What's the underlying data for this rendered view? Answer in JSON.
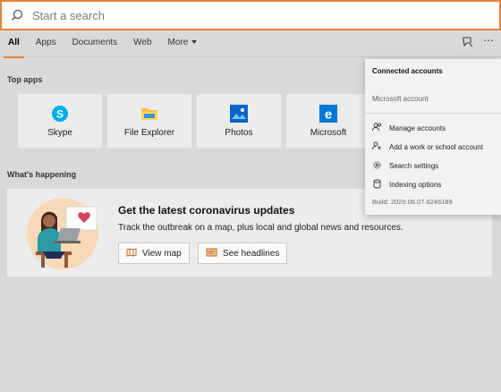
{
  "search": {
    "placeholder": "Start a search"
  },
  "tabs": [
    {
      "label": "All",
      "active": true
    },
    {
      "label": "Apps"
    },
    {
      "label": "Documents"
    },
    {
      "label": "Web"
    },
    {
      "label": "More"
    }
  ],
  "top_apps": {
    "title": "Top apps",
    "items": [
      {
        "label": "Skype",
        "icon": "skype-icon",
        "color": "#00aff0"
      },
      {
        "label": "File Explorer",
        "icon": "folder-icon",
        "color": "#f5c342"
      },
      {
        "label": "Photos",
        "icon": "photos-icon",
        "color": "#0a63c7"
      },
      {
        "label": "Microsoft",
        "icon": "edge-icon",
        "color": "#0078d7"
      }
    ]
  },
  "whats_happening": {
    "title": "What's happening",
    "card": {
      "title": "Get the latest coronavirus updates",
      "description": "Track the outbreak on a map, plus local and global news and resources.",
      "buttons": [
        {
          "label": "View map",
          "icon": "map-icon"
        },
        {
          "label": "See headlines",
          "icon": "news-icon"
        }
      ]
    }
  },
  "dropdown": {
    "header": "Connected accounts",
    "account": "Microsoft account",
    "items": [
      {
        "label": "Manage accounts",
        "icon": "people-icon"
      },
      {
        "label": "Add a work or school account",
        "icon": "add-person-icon"
      },
      {
        "label": "Search settings",
        "icon": "gear-icon"
      },
      {
        "label": "Indexing options",
        "icon": "database-icon"
      }
    ],
    "build": "Build: 2020.06.07.6246189"
  },
  "colors": {
    "accent": "#e8833a",
    "background": "#d9d9d9",
    "tile": "#ececec"
  }
}
